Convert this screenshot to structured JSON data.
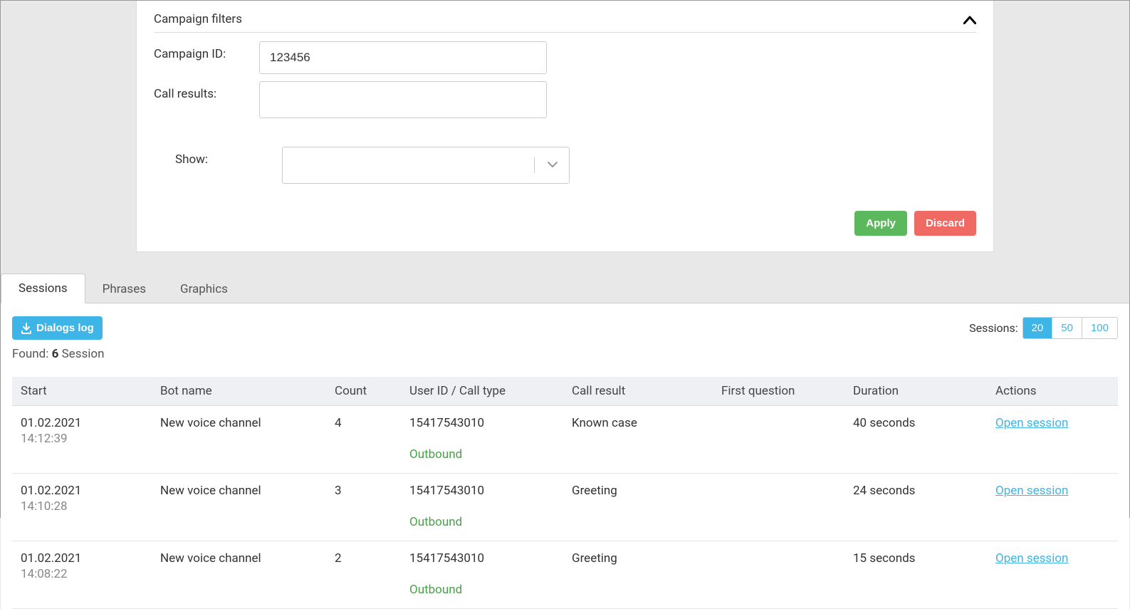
{
  "filters": {
    "title": "Campaign filters",
    "campaign_id_label": "Campaign ID:",
    "campaign_id_value": "123456",
    "call_results_label": "Call results:",
    "show_label": "Show:",
    "apply_label": "Apply",
    "discard_label": "Discard"
  },
  "tabs": {
    "sessions": "Sessions",
    "phrases": "Phrases",
    "graphics": "Graphics"
  },
  "toolbar": {
    "dialogs_log_label": "Dialogs log",
    "sessions_label": "Sessions:",
    "page_sizes": [
      "20",
      "50",
      "100"
    ]
  },
  "found": {
    "prefix": "Found: ",
    "count": "6",
    "suffix": " Session"
  },
  "table": {
    "headers": {
      "start": "Start",
      "bot": "Bot name",
      "count": "Count",
      "user": "User ID / Call type",
      "result": "Call result",
      "first": "First question",
      "duration": "Duration",
      "actions": "Actions"
    },
    "rows": [
      {
        "date": "01.02.2021",
        "time": "14:12:39",
        "bot": "New voice channel",
        "count": "4",
        "user_id": "15417543010",
        "call_type": "Outbound",
        "result": "Known case",
        "first": "",
        "duration": "40 seconds",
        "action": "Open session"
      },
      {
        "date": "01.02.2021",
        "time": "14:10:28",
        "bot": "New voice channel",
        "count": "3",
        "user_id": "15417543010",
        "call_type": "Outbound",
        "result": "Greeting",
        "first": "",
        "duration": "24 seconds",
        "action": "Open session"
      },
      {
        "date": "01.02.2021",
        "time": "14:08:22",
        "bot": "New voice channel",
        "count": "2",
        "user_id": "15417543010",
        "call_type": "Outbound",
        "result": "Greeting",
        "first": "",
        "duration": "15 seconds",
        "action": "Open session"
      }
    ]
  }
}
